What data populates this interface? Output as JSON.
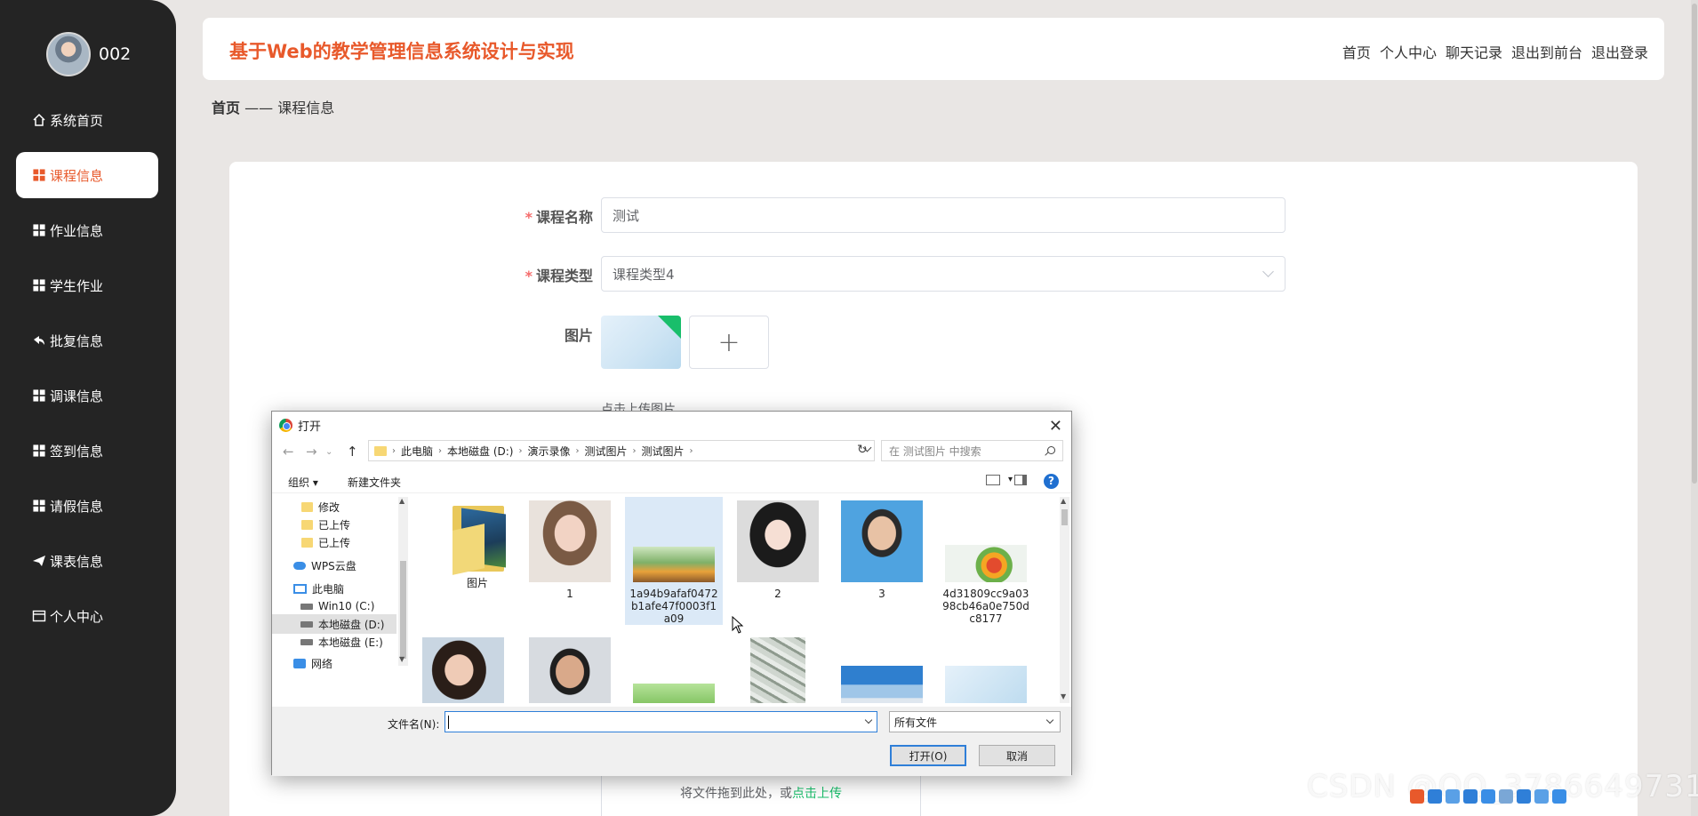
{
  "sidebar": {
    "username": "002",
    "items": [
      {
        "label": "系统首页",
        "icon": "home-icon"
      },
      {
        "label": "课程信息",
        "icon": "grid-icon",
        "active": true
      },
      {
        "label": "作业信息",
        "icon": "grid-icon"
      },
      {
        "label": "学生作业",
        "icon": "grid-icon"
      },
      {
        "label": "批复信息",
        "icon": "reply-icon"
      },
      {
        "label": "调课信息",
        "icon": "grid-icon"
      },
      {
        "label": "签到信息",
        "icon": "grid-icon"
      },
      {
        "label": "请假信息",
        "icon": "grid-icon"
      },
      {
        "label": "课表信息",
        "icon": "plane-icon"
      },
      {
        "label": "个人中心",
        "icon": "card-icon"
      }
    ]
  },
  "header": {
    "title": "基于Web的教学管理信息系统设计与实现",
    "nav": [
      "首页",
      "个人中心",
      "聊天记录",
      "退出到前台",
      "退出登录"
    ]
  },
  "breadcrumb": {
    "home": "首页",
    "sep": "——",
    "current": "课程信息"
  },
  "form": {
    "course_name_label": "课程名称",
    "course_name_value": "测试",
    "course_type_label": "课程类型",
    "course_type_value": "课程类型4",
    "image_label": "图片",
    "upload_plus": "+",
    "upload_hint": "点击上传图片",
    "drop_text": "将文件拖到此处，或",
    "drop_link": "点击上传"
  },
  "dialog": {
    "title": "打开",
    "close": "✕",
    "path": [
      "此电脑",
      "本地磁盘 (D:)",
      "演示录像",
      "测试图片",
      "测试图片"
    ],
    "search_placeholder": "在 测试图片 中搜索",
    "toolbar": {
      "organize": "组织 ▾",
      "new_folder": "新建文件夹",
      "help": "?"
    },
    "tree": [
      {
        "label": "修改",
        "type": "folder"
      },
      {
        "label": "已上传",
        "type": "folder"
      },
      {
        "label": "已上传",
        "type": "folder"
      },
      {
        "label": "WPS云盘",
        "type": "cloud"
      },
      {
        "label": "此电脑",
        "type": "pc"
      },
      {
        "label": "Win10 (C:)",
        "type": "drive"
      },
      {
        "label": "本地磁盘 (D:)",
        "type": "drive",
        "selected": true
      },
      {
        "label": "本地磁盘 (E:)",
        "type": "drive"
      },
      {
        "label": "网络",
        "type": "net"
      }
    ],
    "files": [
      {
        "name": "图片",
        "kind": "folder"
      },
      {
        "name": "1",
        "kind": "portrait-woman"
      },
      {
        "name": "1a94b9afaf0472b1afe47f0003f1a09",
        "kind": "food",
        "selected": true
      },
      {
        "name": "2",
        "kind": "portrait-girl"
      },
      {
        "name": "3",
        "kind": "portrait-man"
      },
      {
        "name": "4d31809cc9a0398cb46a0e750dc8177",
        "kind": "fruit"
      },
      {
        "name": "",
        "kind": "portrait-woman2"
      },
      {
        "name": "",
        "kind": "portrait-man2"
      },
      {
        "name": "",
        "kind": "green"
      },
      {
        "name": "",
        "kind": "money"
      },
      {
        "name": "",
        "kind": "building"
      },
      {
        "name": "",
        "kind": "sky"
      }
    ],
    "filename_label": "文件名(N):",
    "filename_value": "",
    "filetype": "所有文件",
    "open_button": "打开(O)",
    "cancel_button": "取消"
  },
  "watermark": "CSDN @QQ_3786649731",
  "colors": {
    "accent": "#e8592b",
    "sidebar": "#242424",
    "success": "#19be6b"
  }
}
